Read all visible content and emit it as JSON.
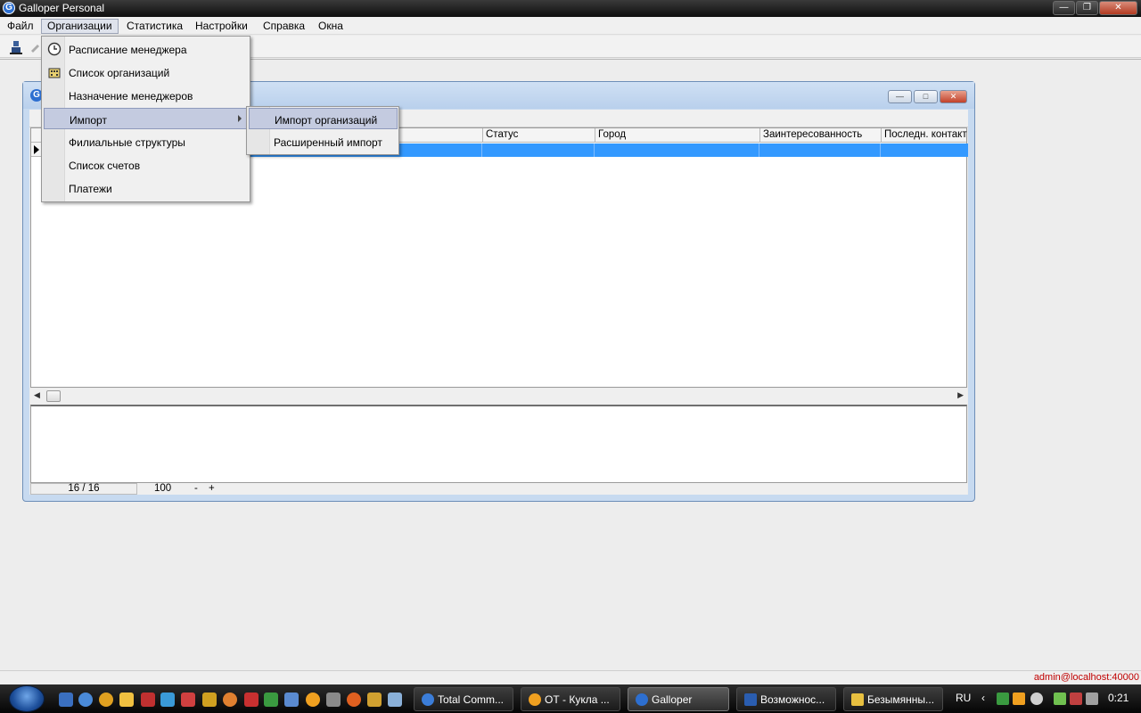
{
  "window": {
    "title": "Galloper Personal",
    "icon_letter": "G",
    "controls": [
      "minimize",
      "maximize",
      "close"
    ]
  },
  "menubar": {
    "items": [
      "Файл",
      "Организации",
      "Статистика",
      "Настройки",
      "Справка",
      "Окна"
    ],
    "open_index": 1
  },
  "dropdown": {
    "items": [
      {
        "label": "Расписание менеджера",
        "icon": "clock-icon"
      },
      {
        "label": "Список организаций",
        "icon": "building-icon"
      },
      {
        "label": "Назначение менеджеров",
        "icon": ""
      },
      {
        "label": "Импорт",
        "icon": "",
        "submenu": true,
        "highlighted": true
      },
      {
        "label": "Филиальные структуры",
        "icon": ""
      },
      {
        "label": "Список счетов",
        "icon": ""
      },
      {
        "label": "Платежи",
        "icon": ""
      }
    ]
  },
  "submenu": {
    "items": [
      {
        "label": "Импорт организаций",
        "highlighted": true
      },
      {
        "label": "Расширенный импорт",
        "highlighted": false
      }
    ]
  },
  "child_window": {
    "icon_letter": "G"
  },
  "grid": {
    "columns": [
      "Статус",
      "Город",
      "Заинтересованность",
      "Последн. контакт"
    ],
    "selected_row_color": "#3399ff"
  },
  "record_status": {
    "position": "16 / 16",
    "page_size": "100",
    "minus": "-",
    "plus": "+"
  },
  "app_status": {
    "user": "admin@localhost:40000"
  },
  "taskbar": {
    "tasks": [
      {
        "label": "Total Comm...",
        "icon": "total-commander-icon",
        "color": "#3b7dd8"
      },
      {
        "label": "ОТ - Кукла ...",
        "icon": "aimp-icon",
        "color": "#f0a020"
      },
      {
        "label": "Galloper",
        "icon": "galloper-icon",
        "color": "#2d6fd0"
      },
      {
        "label": "Возможнос...",
        "icon": "word-icon",
        "color": "#2a5db0"
      },
      {
        "label": "Безымянны...",
        "icon": "paint-icon",
        "color": "#e8c040"
      }
    ],
    "active_task": 2,
    "language": "RU",
    "clock": "0:21"
  }
}
